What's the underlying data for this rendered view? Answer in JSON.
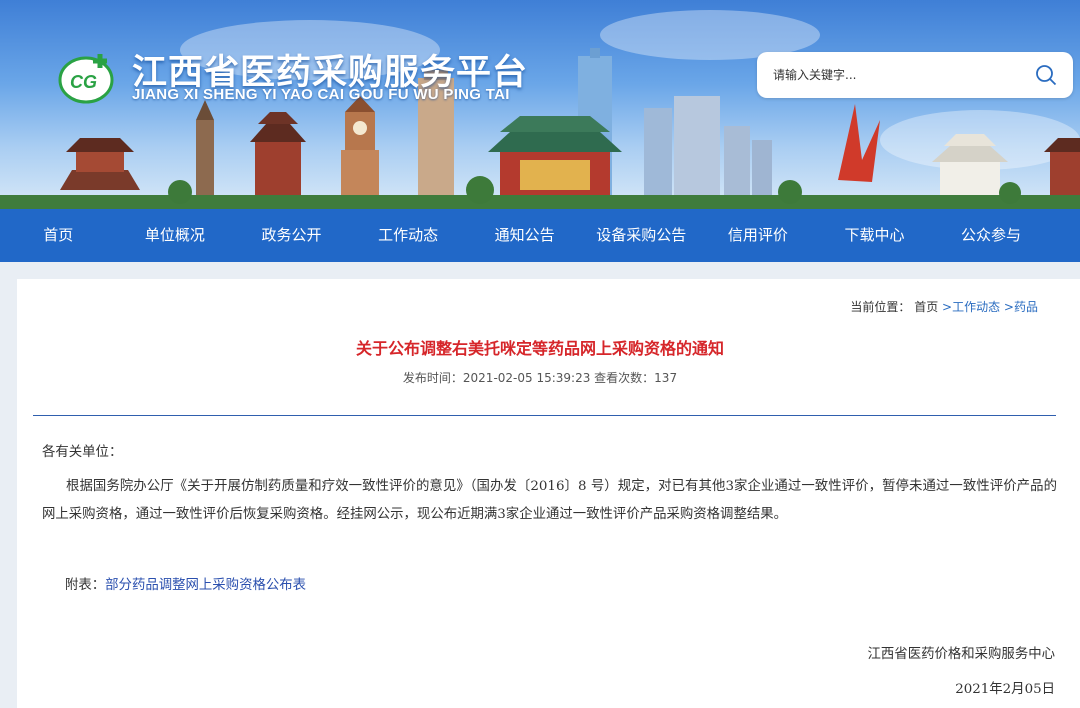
{
  "site": {
    "title": "江西省医药采购服务平台",
    "subtitle": "JIANG XI SHENG YI YAO CAI GOU FU WU PING TAI",
    "logo_text": "CG"
  },
  "search": {
    "placeholder": "请输入关键字..."
  },
  "nav": {
    "items": [
      {
        "label": "首页"
      },
      {
        "label": "单位概况"
      },
      {
        "label": "政务公开"
      },
      {
        "label": "工作动态"
      },
      {
        "label": "通知公告"
      },
      {
        "label": "设备采购公告"
      },
      {
        "label": "信用评价"
      },
      {
        "label": "下载中心"
      },
      {
        "label": "公众参与"
      }
    ]
  },
  "breadcrumb": {
    "prefix": "当前位置：",
    "home": "首页",
    "sep1": " >",
    "level1": "工作动态",
    "sep2": " >",
    "level2": "药品"
  },
  "article": {
    "title": "关于公布调整右美托咪定等药品网上采购资格的通知",
    "meta": "发布时间：2021-02-05 15:39:23 查看次数：137",
    "salutation": "各有关单位：",
    "paragraph": "根据国务院办公厅《关于开展仿制药质量和疗效一致性评价的意见》（国办发〔2016〕8 号）规定，对已有其他3家企业通过一致性评价，暂停未通过一致性评价产品的网上采购资格，通过一致性评价后恢复采购资格。经挂网公示，现公布近期满3家企业通过一致性评价产品采购资格调整结果。",
    "attachment_label": "附表：",
    "attachment_link": "部分药品调整网上采购资格公布表",
    "sign_org": "江西省医药价格和采购服务中心",
    "sign_date": "2021年2月05日"
  },
  "colors": {
    "nav_bg": "#2168c8",
    "title_red": "#d6262a",
    "divider": "#2f5fae",
    "link": "#2a6cc0"
  }
}
